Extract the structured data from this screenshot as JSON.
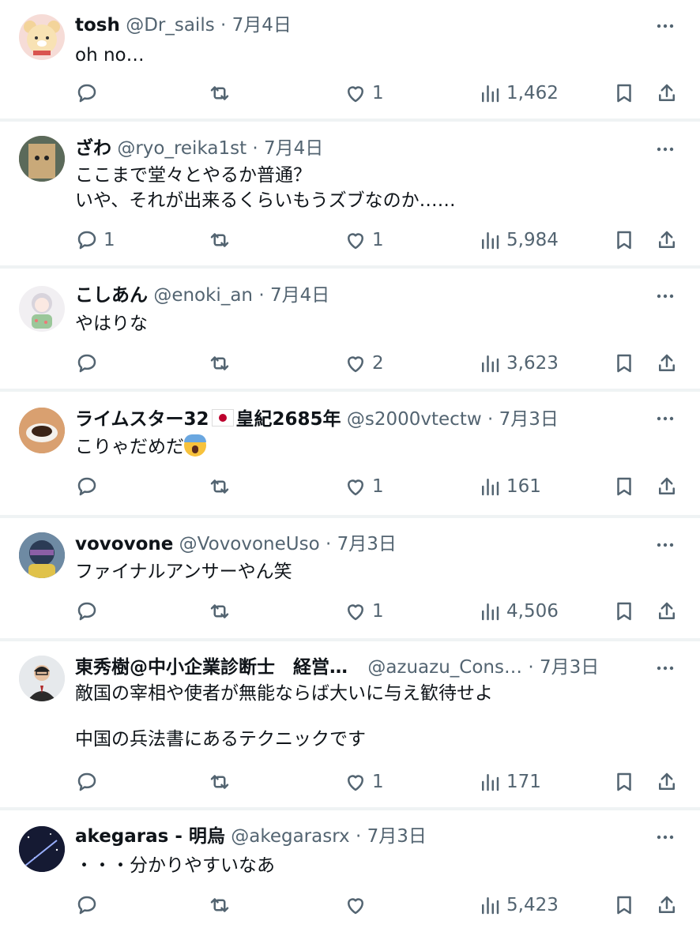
{
  "tweets": [
    {
      "name": "tosh",
      "handle": "@Dr_sails",
      "date": "7月4日",
      "text": "oh no…",
      "replies": "",
      "retweets": "",
      "likes": "1",
      "views": "1,462",
      "avatar_color": "#f6dcd7"
    },
    {
      "name": "ざわ",
      "handle": "@ryo_reika1st",
      "date": "7月4日",
      "text": "ここまで堂々とやるか普通？\nいや、それが出来るくらいもうズブなのか……",
      "replies": "1",
      "retweets": "",
      "likes": "1",
      "views": "5,984",
      "avatar_color": "#8a6d4f"
    },
    {
      "name": "こしあん",
      "handle": "@enoki_an",
      "date": "7月4日",
      "text": "やはりな",
      "replies": "",
      "retweets": "",
      "likes": "2",
      "views": "3,623",
      "avatar_color": "#e9e6ea"
    },
    {
      "name_a": "ライムスター32",
      "name_b": "皇紀2685年",
      "handle": "@s2000vtectw",
      "date": "7月3日",
      "text": "こりゃだめだ",
      "replies": "",
      "retweets": "",
      "likes": "1",
      "views": "161",
      "avatar_color": "#c98d5d"
    },
    {
      "name": "vovovone",
      "handle": "@VovovoneUso",
      "date": "7月3日",
      "text": "ファイナルアンサーやん笑",
      "replies": "",
      "retweets": "",
      "likes": "1",
      "views": "4,506",
      "avatar_color": "#2f4a63"
    },
    {
      "name": "東秀樹@中小企業診断士　経営…",
      "handle": "@azuazu_Cons…",
      "date": "7月3日",
      "text": "敵国の宰相や使者が無能ならば大いに与え歓待せよ\n\n中国の兵法書にあるテクニックです",
      "replies": "",
      "retweets": "",
      "likes": "1",
      "views": "171",
      "avatar_color": "#dfe3e8"
    },
    {
      "name": "akegaras - 明烏",
      "handle": "@akegarasrx",
      "date": "7月3日",
      "text": "・・・分かりやすいなあ",
      "replies": "",
      "retweets": "",
      "likes": "",
      "views": "5,423",
      "avatar_color": "#1d2240"
    }
  ],
  "icons": {
    "reply": "reply-icon",
    "retweet": "retweet-icon",
    "like": "heart-icon",
    "views": "views-icon",
    "bookmark": "bookmark-icon",
    "share": "share-icon",
    "more": "more-icon"
  },
  "colors": {
    "text": "#0f1419",
    "muted": "#536471",
    "separator": "#eff3f4"
  }
}
